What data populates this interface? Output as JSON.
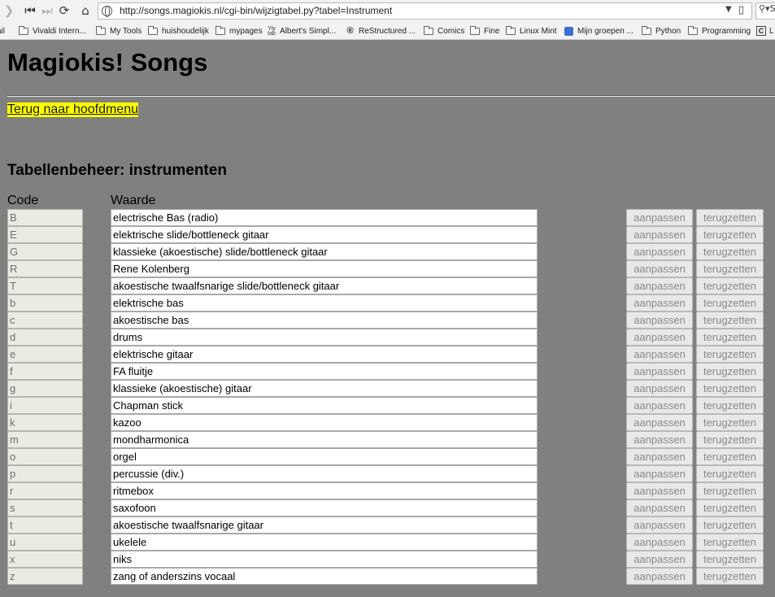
{
  "browser": {
    "url": "http://songs.magiokis.nl/cgi-bin/wijzigtabel.py?tabel=Instrument",
    "search_placeholder": "S",
    "bookmarks": [
      {
        "label": "ail",
        "icon": "mail-icon"
      },
      {
        "label": "Vivaldi Intern...",
        "icon": "folder-icon"
      },
      {
        "label": "My Tools",
        "icon": "folder-icon"
      },
      {
        "label": "huishoudelijk",
        "icon": "folder-icon"
      },
      {
        "label": "mypages",
        "icon": "folder-icon"
      },
      {
        "label": "Albert's Simpl...",
        "icon": "site-icon"
      },
      {
        "label": "ReStructured ...",
        "icon": "restructured-icon"
      },
      {
        "label": "Comics",
        "icon": "folder-icon"
      },
      {
        "label": "Fine",
        "icon": "folder-icon"
      },
      {
        "label": "Linux Mint",
        "icon": "folder-icon"
      },
      {
        "label": "Mijn groepen ...",
        "icon": "groups-icon"
      },
      {
        "label": "Python",
        "icon": "folder-icon"
      },
      {
        "label": "Programming",
        "icon": "folder-icon"
      },
      {
        "label": "L",
        "icon": "c-icon"
      }
    ]
  },
  "page": {
    "title": "Magiokis! Songs",
    "back_link": "Terug naar hoofdmenu",
    "section_title": "Tabellenbeheer: instrumenten",
    "col_code": "Code",
    "col_value": "Waarde",
    "btn_edit": "aanpassen",
    "btn_reset": "terugzetten"
  },
  "rows": [
    {
      "code": "B",
      "value": "electrische Bas (radio)"
    },
    {
      "code": "E",
      "value": "elektrische slide/bottleneck gitaar"
    },
    {
      "code": "G",
      "value": "klassieke (akoestische) slide/bottleneck gitaar"
    },
    {
      "code": "R",
      "value": "Rene Kolenberg"
    },
    {
      "code": "T",
      "value": "akoestische twaalfsnarige slide/bottleneck gitaar"
    },
    {
      "code": "b",
      "value": "elektrische bas"
    },
    {
      "code": "c",
      "value": "akoestische bas"
    },
    {
      "code": "d",
      "value": "drums"
    },
    {
      "code": "e",
      "value": "elektrische gitaar"
    },
    {
      "code": "f",
      "value": "FA fluitje"
    },
    {
      "code": "g",
      "value": "klassieke (akoestische) gitaar"
    },
    {
      "code": "i",
      "value": "Chapman stick"
    },
    {
      "code": "k",
      "value": "kazoo"
    },
    {
      "code": "m",
      "value": "mondharmonica"
    },
    {
      "code": "o",
      "value": "orgel"
    },
    {
      "code": "p",
      "value": "percussie (div.)"
    },
    {
      "code": "r",
      "value": "ritmebox"
    },
    {
      "code": "s",
      "value": "saxofoon"
    },
    {
      "code": "t",
      "value": "akoestische twaalfsnarige gitaar"
    },
    {
      "code": "u",
      "value": "ukelele"
    },
    {
      "code": "x",
      "value": "niks"
    },
    {
      "code": "z",
      "value": "zang of anderszins vocaal"
    }
  ]
}
